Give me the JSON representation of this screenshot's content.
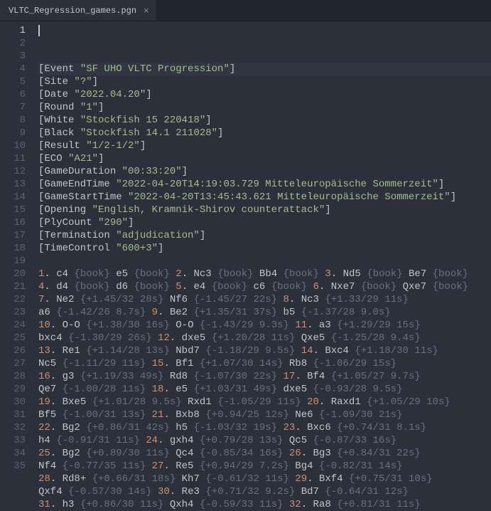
{
  "tab": {
    "filename": "VLTC_Regression_games.pgn"
  },
  "activeLine": 1,
  "lines": [
    {
      "n": 1,
      "seg": [
        [
          "plain",
          "[Event "
        ],
        [
          "str",
          "\"SF UHO VLTC Progression\""
        ],
        [
          "plain",
          "]"
        ]
      ]
    },
    {
      "n": 2,
      "seg": [
        [
          "plain",
          "[Site "
        ],
        [
          "str",
          "\"?\""
        ],
        [
          "plain",
          "]"
        ]
      ]
    },
    {
      "n": 3,
      "seg": [
        [
          "plain",
          "[Date "
        ],
        [
          "str",
          "\"2022.04.20\""
        ],
        [
          "plain",
          "]"
        ]
      ]
    },
    {
      "n": 4,
      "seg": [
        [
          "plain",
          "[Round "
        ],
        [
          "str",
          "\"1\""
        ],
        [
          "plain",
          "]"
        ]
      ]
    },
    {
      "n": 5,
      "seg": [
        [
          "plain",
          "[White "
        ],
        [
          "str",
          "\"Stockfish 15 220418\""
        ],
        [
          "plain",
          "]"
        ]
      ]
    },
    {
      "n": 6,
      "seg": [
        [
          "plain",
          "[Black "
        ],
        [
          "str",
          "\"Stockfish 14.1 211028\""
        ],
        [
          "plain",
          "]"
        ]
      ]
    },
    {
      "n": 7,
      "seg": [
        [
          "plain",
          "[Result "
        ],
        [
          "str",
          "\"1/2-1/2\""
        ],
        [
          "plain",
          "]"
        ]
      ]
    },
    {
      "n": 8,
      "seg": [
        [
          "plain",
          "[ECO "
        ],
        [
          "str",
          "\"A21\""
        ],
        [
          "plain",
          "]"
        ]
      ]
    },
    {
      "n": 9,
      "seg": [
        [
          "plain",
          "[GameDuration "
        ],
        [
          "str",
          "\"00:33:20\""
        ],
        [
          "plain",
          "]"
        ]
      ]
    },
    {
      "n": 10,
      "seg": [
        [
          "plain",
          "[GameEndTime "
        ],
        [
          "str",
          "\"2022-04-20T14:19:03.729 Mitteleuropäische Sommerzeit\""
        ],
        [
          "plain",
          "]"
        ]
      ]
    },
    {
      "n": 11,
      "seg": [
        [
          "plain",
          "[GameStartTime "
        ],
        [
          "str",
          "\"2022-04-20T13:45:43.621 Mitteleuropäische Sommerzeit\""
        ],
        [
          "plain",
          "]"
        ]
      ]
    },
    {
      "n": 12,
      "seg": [
        [
          "plain",
          "[Opening "
        ],
        [
          "str",
          "\"English, Kramnik-Shirov counterattack\""
        ],
        [
          "plain",
          "]"
        ]
      ]
    },
    {
      "n": 13,
      "seg": [
        [
          "plain",
          "[PlyCount "
        ],
        [
          "str",
          "\"290\""
        ],
        [
          "plain",
          "]"
        ]
      ]
    },
    {
      "n": 14,
      "seg": [
        [
          "plain",
          "[Termination "
        ],
        [
          "str",
          "\"adjudication\""
        ],
        [
          "plain",
          "]"
        ]
      ]
    },
    {
      "n": 15,
      "seg": [
        [
          "plain",
          "[TimeControl "
        ],
        [
          "str",
          "\"600+3\""
        ],
        [
          "plain",
          "]"
        ]
      ]
    },
    {
      "n": 16,
      "seg": [
        [
          "plain",
          ""
        ]
      ]
    },
    {
      "n": 17,
      "seg": [
        [
          "num",
          "1"
        ],
        [
          "plain",
          ". c4 "
        ],
        [
          "comment",
          "{book}"
        ],
        [
          "plain",
          " e5 "
        ],
        [
          "comment",
          "{book}"
        ],
        [
          "plain",
          " "
        ],
        [
          "num",
          "2"
        ],
        [
          "plain",
          ". Nc3 "
        ],
        [
          "comment",
          "{book}"
        ],
        [
          "plain",
          " Bb4 "
        ],
        [
          "comment",
          "{book}"
        ],
        [
          "plain",
          " "
        ],
        [
          "num",
          "3"
        ],
        [
          "plain",
          ". Nd5 "
        ],
        [
          "comment",
          "{book}"
        ],
        [
          "plain",
          " Be7 "
        ],
        [
          "comment",
          "{book}"
        ]
      ]
    },
    {
      "n": 18,
      "seg": [
        [
          "num",
          "4"
        ],
        [
          "plain",
          ". d4 "
        ],
        [
          "comment",
          "{book}"
        ],
        [
          "plain",
          " d6 "
        ],
        [
          "comment",
          "{book}"
        ],
        [
          "plain",
          " "
        ],
        [
          "num",
          "5"
        ],
        [
          "plain",
          ". e4 "
        ],
        [
          "comment",
          "{book}"
        ],
        [
          "plain",
          " c6 "
        ],
        [
          "comment",
          "{book}"
        ],
        [
          "plain",
          " "
        ],
        [
          "num",
          "6"
        ],
        [
          "plain",
          ". Nxe7 "
        ],
        [
          "comment",
          "{book}"
        ],
        [
          "plain",
          " Qxe7 "
        ],
        [
          "comment",
          "{book}"
        ]
      ]
    },
    {
      "n": 19,
      "seg": [
        [
          "num",
          "7"
        ],
        [
          "plain",
          ". Ne2 "
        ],
        [
          "comment",
          "{+1.45/32 28s}"
        ],
        [
          "plain",
          " Nf6 "
        ],
        [
          "comment",
          "{-1.45/27 22s}"
        ],
        [
          "plain",
          " "
        ],
        [
          "num",
          "8"
        ],
        [
          "plain",
          ". Nc3 "
        ],
        [
          "comment",
          "{+1.33/29 11s}"
        ]
      ]
    },
    {
      "n": 20,
      "seg": [
        [
          "plain",
          "a6 "
        ],
        [
          "comment",
          "{-1.42/26 8.7s}"
        ],
        [
          "plain",
          " "
        ],
        [
          "num",
          "9"
        ],
        [
          "plain",
          ". Be2 "
        ],
        [
          "comment",
          "{+1.35/31 37s}"
        ],
        [
          "plain",
          " b5 "
        ],
        [
          "comment",
          "{-1.37/28 9.0s}"
        ]
      ]
    },
    {
      "n": 21,
      "seg": [
        [
          "num",
          "10"
        ],
        [
          "plain",
          ". O-O "
        ],
        [
          "comment",
          "{+1.38/30 16s}"
        ],
        [
          "plain",
          " O-O "
        ],
        [
          "comment",
          "{-1.43/29 9.3s}"
        ],
        [
          "plain",
          " "
        ],
        [
          "num",
          "11"
        ],
        [
          "plain",
          ". a3 "
        ],
        [
          "comment",
          "{+1.29/29 15s}"
        ]
      ]
    },
    {
      "n": 22,
      "seg": [
        [
          "plain",
          "bxc4 "
        ],
        [
          "comment",
          "{-1.30/29 26s}"
        ],
        [
          "plain",
          " "
        ],
        [
          "num",
          "12"
        ],
        [
          "plain",
          ". dxe5 "
        ],
        [
          "comment",
          "{+1.20/28 11s}"
        ],
        [
          "plain",
          " Qxe5 "
        ],
        [
          "comment",
          "{-1.25/28 9.4s}"
        ]
      ]
    },
    {
      "n": 23,
      "seg": [
        [
          "num",
          "13"
        ],
        [
          "plain",
          ". Re1 "
        ],
        [
          "comment",
          "{+1.14/28 13s}"
        ],
        [
          "plain",
          " Nbd7 "
        ],
        [
          "comment",
          "{-1.18/29 9.5s}"
        ],
        [
          "plain",
          " "
        ],
        [
          "num",
          "14"
        ],
        [
          "plain",
          ". Bxc4 "
        ],
        [
          "comment",
          "{+1.18/30 11s}"
        ]
      ]
    },
    {
      "n": 24,
      "seg": [
        [
          "plain",
          "Nc5 "
        ],
        [
          "comment",
          "{-1.11/29 11s}"
        ],
        [
          "plain",
          " "
        ],
        [
          "num",
          "15"
        ],
        [
          "plain",
          ". Bf1 "
        ],
        [
          "comment",
          "{+1.07/30 14s}"
        ],
        [
          "plain",
          " Rb8 "
        ],
        [
          "comment",
          "{-1.06/29 15s}"
        ]
      ]
    },
    {
      "n": 25,
      "seg": [
        [
          "num",
          "16"
        ],
        [
          "plain",
          ". g3 "
        ],
        [
          "comment",
          "{+1.19/33 49s}"
        ],
        [
          "plain",
          " Rd8 "
        ],
        [
          "comment",
          "{-1.07/30 22s}"
        ],
        [
          "plain",
          " "
        ],
        [
          "num",
          "17"
        ],
        [
          "plain",
          ". Bf4 "
        ],
        [
          "comment",
          "{+1.05/27 9.7s}"
        ]
      ]
    },
    {
      "n": 26,
      "seg": [
        [
          "plain",
          "Qe7 "
        ],
        [
          "comment",
          "{-1.00/28 11s}"
        ],
        [
          "plain",
          " "
        ],
        [
          "num",
          "18"
        ],
        [
          "plain",
          ". e5 "
        ],
        [
          "comment",
          "{+1.03/31 49s}"
        ],
        [
          "plain",
          " dxe5 "
        ],
        [
          "comment",
          "{-0.93/28 9.5s}"
        ]
      ]
    },
    {
      "n": 27,
      "seg": [
        [
          "num",
          "19"
        ],
        [
          "plain",
          ". Bxe5 "
        ],
        [
          "comment",
          "{+1.01/28 9.5s}"
        ],
        [
          "plain",
          " Rxd1 "
        ],
        [
          "comment",
          "{-1.05/29 11s}"
        ],
        [
          "plain",
          " "
        ],
        [
          "num",
          "20"
        ],
        [
          "plain",
          ". Raxd1 "
        ],
        [
          "comment",
          "{+1.05/29 10s}"
        ]
      ]
    },
    {
      "n": 28,
      "seg": [
        [
          "plain",
          "Bf5 "
        ],
        [
          "comment",
          "{-1.00/31 13s}"
        ],
        [
          "plain",
          " "
        ],
        [
          "num",
          "21"
        ],
        [
          "plain",
          ". Bxb8 "
        ],
        [
          "comment",
          "{+0.94/25 12s}"
        ],
        [
          "plain",
          " Ne6 "
        ],
        [
          "comment",
          "{-1.09/30 21s}"
        ]
      ]
    },
    {
      "n": 29,
      "seg": [
        [
          "num",
          "22"
        ],
        [
          "plain",
          ". Bg2 "
        ],
        [
          "comment",
          "{+0.86/31 42s}"
        ],
        [
          "plain",
          " h5 "
        ],
        [
          "comment",
          "{-1.03/32 19s}"
        ],
        [
          "plain",
          " "
        ],
        [
          "num",
          "23"
        ],
        [
          "plain",
          ". Bxc6 "
        ],
        [
          "comment",
          "{+0.74/31 8.1s}"
        ]
      ]
    },
    {
      "n": 30,
      "seg": [
        [
          "plain",
          "h4 "
        ],
        [
          "comment",
          "{-0.91/31 11s}"
        ],
        [
          "plain",
          " "
        ],
        [
          "num",
          "24"
        ],
        [
          "plain",
          ". gxh4 "
        ],
        [
          "comment",
          "{+0.79/28 13s}"
        ],
        [
          "plain",
          " Qc5 "
        ],
        [
          "comment",
          "{-0.87/33 16s}"
        ]
      ]
    },
    {
      "n": 31,
      "seg": [
        [
          "num",
          "25"
        ],
        [
          "plain",
          ". Bg2 "
        ],
        [
          "comment",
          "{+0.89/30 11s}"
        ],
        [
          "plain",
          " Qc4 "
        ],
        [
          "comment",
          "{-0.85/34 16s}"
        ],
        [
          "plain",
          " "
        ],
        [
          "num",
          "26"
        ],
        [
          "plain",
          ". Bg3 "
        ],
        [
          "comment",
          "{+0.84/31 22s}"
        ]
      ]
    },
    {
      "n": 32,
      "seg": [
        [
          "plain",
          "Nf4 "
        ],
        [
          "comment",
          "{-0.77/35 11s}"
        ],
        [
          "plain",
          " "
        ],
        [
          "num",
          "27"
        ],
        [
          "plain",
          ". Re5 "
        ],
        [
          "comment",
          "{+0.94/29 7.2s}"
        ],
        [
          "plain",
          " Bg4 "
        ],
        [
          "comment",
          "{-0.82/31 14s}"
        ]
      ]
    },
    {
      "n": 33,
      "seg": [
        [
          "num",
          "28"
        ],
        [
          "plain",
          ". Rd8+ "
        ],
        [
          "comment",
          "{+0.66/31 18s}"
        ],
        [
          "plain",
          " Kh7 "
        ],
        [
          "comment",
          "{-0.61/32 11s}"
        ],
        [
          "plain",
          " "
        ],
        [
          "num",
          "29"
        ],
        [
          "plain",
          ". Bxf4 "
        ],
        [
          "comment",
          "{+0.75/31 10s}"
        ]
      ]
    },
    {
      "n": 34,
      "seg": [
        [
          "plain",
          "Qxf4 "
        ],
        [
          "comment",
          "{-0.57/30 14s}"
        ],
        [
          "plain",
          " "
        ],
        [
          "num",
          "30"
        ],
        [
          "plain",
          ". Re3 "
        ],
        [
          "comment",
          "{+0.71/32 9.2s}"
        ],
        [
          "plain",
          " Bd7 "
        ],
        [
          "comment",
          "{-0.64/31 12s}"
        ]
      ]
    },
    {
      "n": 35,
      "seg": [
        [
          "num",
          "31"
        ],
        [
          "plain",
          ". h3 "
        ],
        [
          "comment",
          "{+0.86/30 11s}"
        ],
        [
          "plain",
          " Qxh4 "
        ],
        [
          "comment",
          "{-0.59/33 11s}"
        ],
        [
          "plain",
          " "
        ],
        [
          "num",
          "32"
        ],
        [
          "plain",
          ". Ra8 "
        ],
        [
          "comment",
          "{+0.81/31 11s}"
        ]
      ]
    }
  ]
}
